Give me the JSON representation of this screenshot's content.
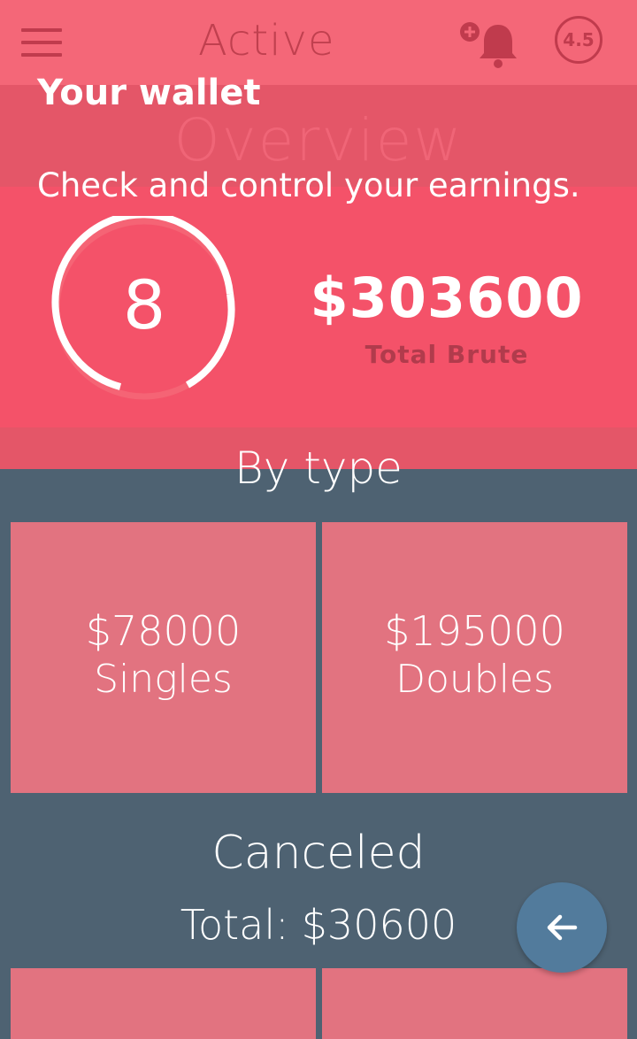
{
  "topbar": {
    "title": "Active",
    "menu_icon": "hamburger-menu-icon",
    "notification_icon": "bell-icon",
    "rating": "4.5"
  },
  "overview": {
    "title": "Overview"
  },
  "wallet": {
    "title": "Your wallet",
    "subtitle": "Check and control your earnings.",
    "count": "8",
    "total_amount": "$303600",
    "total_label": "Total Brute"
  },
  "by_type": {
    "title": "By type",
    "cards": [
      {
        "amount": "$78000",
        "label": "Singles"
      },
      {
        "amount": "$195000",
        "label": "Doubles"
      }
    ]
  },
  "canceled": {
    "title": "Canceled",
    "total_label": "Total:",
    "total_value": "$30600"
  },
  "fab": {
    "icon": "arrow-left-icon"
  },
  "colors": {
    "primary": "#f45269",
    "dark_band": "#e45668",
    "background": "#4e6272",
    "card": "#e27380",
    "fab": "#527b9c"
  }
}
